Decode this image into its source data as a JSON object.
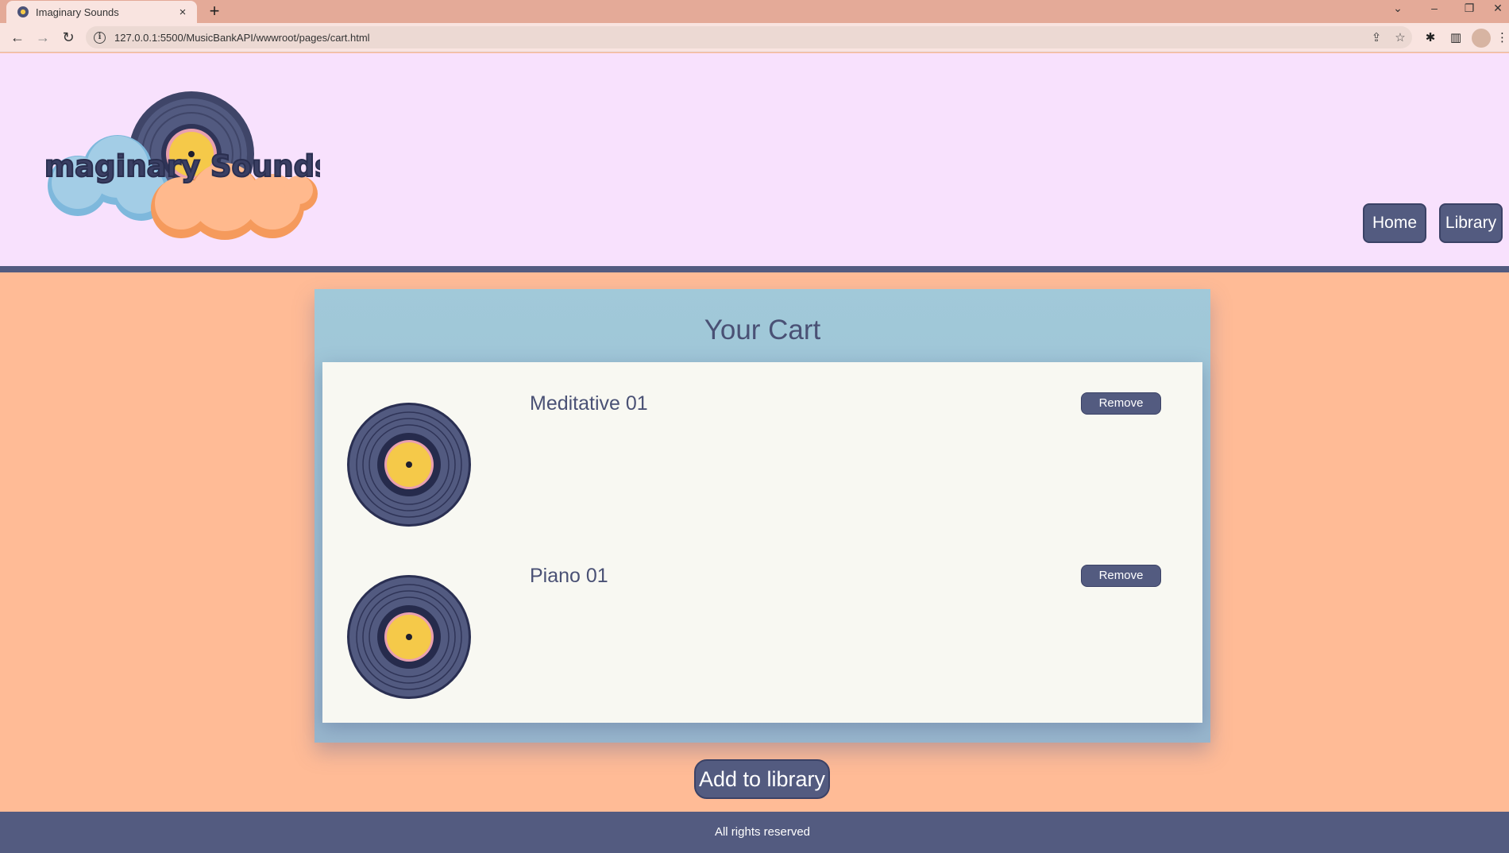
{
  "browser": {
    "tab_title": "Imaginary Sounds",
    "tab_close": "×",
    "new_tab": "+",
    "url": "127.0.0.1:5500/MusicBankAPI/wwwroot/pages/cart.html",
    "icons": {
      "back": "←",
      "forward": "→",
      "reload": "↻",
      "share": "⇪",
      "bookmark": "☆",
      "extensions": "✱",
      "sidepanel": "▥",
      "menu": "⋮",
      "tab_list": "⌄",
      "minimize": "–",
      "restore": "❐",
      "close": "✕"
    }
  },
  "header": {
    "logo_text": "Imaginary Sounds",
    "nav": [
      {
        "label": "Home"
      },
      {
        "label": "Library"
      }
    ]
  },
  "cart": {
    "title": "Your Cart",
    "items": [
      {
        "title": "Meditative 01",
        "remove_label": "Remove"
      },
      {
        "title": "Piano 01",
        "remove_label": "Remove"
      }
    ],
    "add_label": "Add to library"
  },
  "footer": {
    "text": "All rights reserved"
  },
  "colors": {
    "header_bg": "#f8e1fd",
    "page_bg": "#ffbb96",
    "accent": "#535b80",
    "panel": "#a1c9d9",
    "list_bg": "#f8f8f2",
    "record_label": "#f5c949"
  }
}
